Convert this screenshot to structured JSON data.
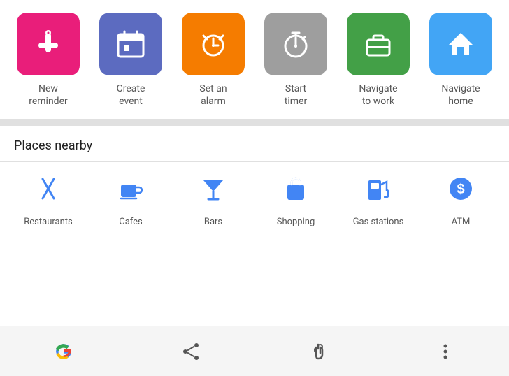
{
  "shortcuts": [
    {
      "id": "new-reminder",
      "label": "New\nreminder",
      "label_display": "New reminder",
      "label_line1": "New",
      "label_line2": "reminder",
      "bg_class": "bg-pink",
      "icon": "reminder"
    },
    {
      "id": "create-event",
      "label": "Create event",
      "label_line1": "Create",
      "label_line2": "event",
      "bg_class": "bg-purple",
      "icon": "calendar"
    },
    {
      "id": "set-alarm",
      "label": "Set an alarm",
      "label_line1": "Set an",
      "label_line2": "alarm",
      "bg_class": "bg-orange",
      "icon": "alarm"
    },
    {
      "id": "start-timer",
      "label": "Start timer",
      "label_line1": "Start",
      "label_line2": "timer",
      "bg_class": "bg-gray",
      "icon": "timer"
    },
    {
      "id": "navigate-work",
      "label": "Navigate to work",
      "label_line1": "Navigate",
      "label_line2": "to work",
      "bg_class": "bg-green",
      "icon": "work"
    },
    {
      "id": "navigate-home",
      "label": "Navigate home",
      "label_line1": "Navigate",
      "label_line2": "home",
      "bg_class": "bg-blue",
      "icon": "home"
    }
  ],
  "places_nearby": {
    "title": "Places nearby",
    "items": [
      {
        "id": "restaurants",
        "label": "Restaurants",
        "icon": "✕"
      },
      {
        "id": "cafes",
        "label": "Cafes",
        "icon": "☕"
      },
      {
        "id": "bars",
        "label": "Bars",
        "icon": "🍸"
      },
      {
        "id": "shopping",
        "label": "Shopping",
        "icon": "🛍"
      },
      {
        "id": "gas-stations",
        "label": "Gas stations",
        "icon": "⛽"
      },
      {
        "id": "atm",
        "label": "ATM",
        "icon": "$"
      }
    ]
  },
  "bottom_nav": {
    "google_label": "G",
    "share_label": "share",
    "touch_label": "touch",
    "more_label": "more"
  }
}
